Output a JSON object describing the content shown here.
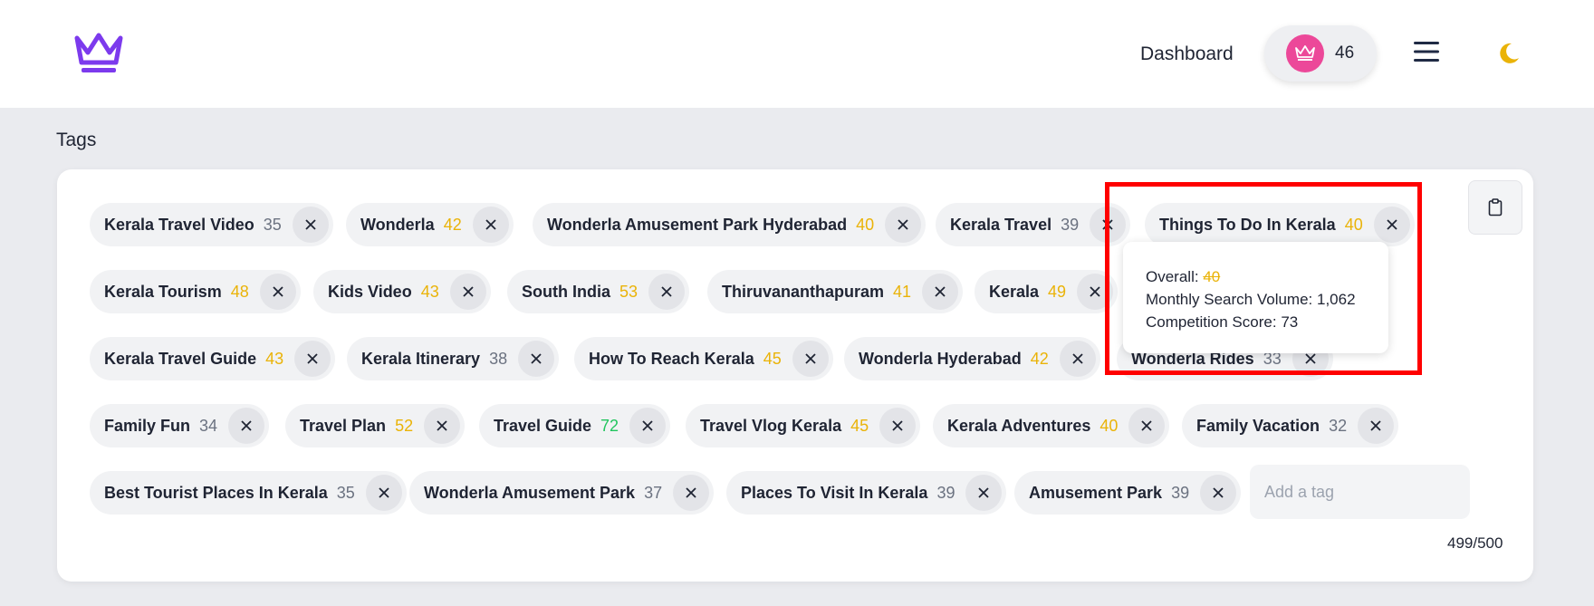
{
  "header": {
    "nav_link": "Dashboard",
    "points": "46",
    "colors": {
      "logo": "#7c3aed",
      "avatar": "#ec4899",
      "moon": "#eab308"
    },
    "icons": [
      "crown-logo-icon",
      "crown-icon",
      "menu-icon",
      "moon-icon"
    ]
  },
  "section": {
    "title": "Tags"
  },
  "tags": [
    {
      "label": "Kerala Travel Video",
      "score": "35",
      "color": "gray"
    },
    {
      "label": "Wonderla",
      "score": "42",
      "color": "yellow"
    },
    {
      "label": "Wonderla Amusement Park Hyderabad",
      "score": "40",
      "color": "yellow"
    },
    {
      "label": "Kerala Travel",
      "score": "39",
      "color": "gray"
    },
    {
      "label": "Things To Do In Kerala",
      "score": "40",
      "color": "yellow"
    },
    {
      "label": "Kerala Tourism",
      "score": "48",
      "color": "yellow"
    },
    {
      "label": "Kids Video",
      "score": "43",
      "color": "yellow"
    },
    {
      "label": "South India",
      "score": "53",
      "color": "yellow"
    },
    {
      "label": "Thiruvananthapuram",
      "score": "41",
      "color": "yellow"
    },
    {
      "label": "Kerala",
      "score": "49",
      "color": "yellow"
    },
    {
      "label": "Kerala Travel Guide",
      "score": "43",
      "color": "yellow"
    },
    {
      "label": "Kerala Itinerary",
      "score": "38",
      "color": "gray"
    },
    {
      "label": "How To Reach Kerala",
      "score": "45",
      "color": "yellow"
    },
    {
      "label": "Wonderla Hyderabad",
      "score": "42",
      "color": "yellow"
    },
    {
      "label": "Wonderla Rides",
      "score": "33",
      "color": "gray"
    },
    {
      "label": "Family Fun",
      "score": "34",
      "color": "gray"
    },
    {
      "label": "Travel Plan",
      "score": "52",
      "color": "yellow"
    },
    {
      "label": "Travel Guide",
      "score": "72",
      "color": "green"
    },
    {
      "label": "Travel Vlog Kerala",
      "score": "45",
      "color": "yellow"
    },
    {
      "label": "Kerala Adventures",
      "score": "40",
      "color": "yellow"
    },
    {
      "label": "Family Vacation",
      "score": "32",
      "color": "gray"
    },
    {
      "label": "Best Tourist Places In Kerala",
      "score": "35",
      "color": "gray"
    },
    {
      "label": "Wonderla Amusement Park",
      "score": "37",
      "color": "gray"
    },
    {
      "label": "Places To Visit In Kerala",
      "score": "39",
      "color": "gray"
    },
    {
      "label": "Amusement Park",
      "score": "39",
      "color": "gray"
    }
  ],
  "tooltip": {
    "overall_label": "Overall:",
    "overall_value": "40",
    "volume_label": "Monthly Search Volume:",
    "volume_value": "1,062",
    "competition_label": "Competition Score:",
    "competition_value": "73"
  },
  "input": {
    "placeholder": "Add a tag"
  },
  "char_count": "499/500",
  "highlight_color": "#ff0000"
}
